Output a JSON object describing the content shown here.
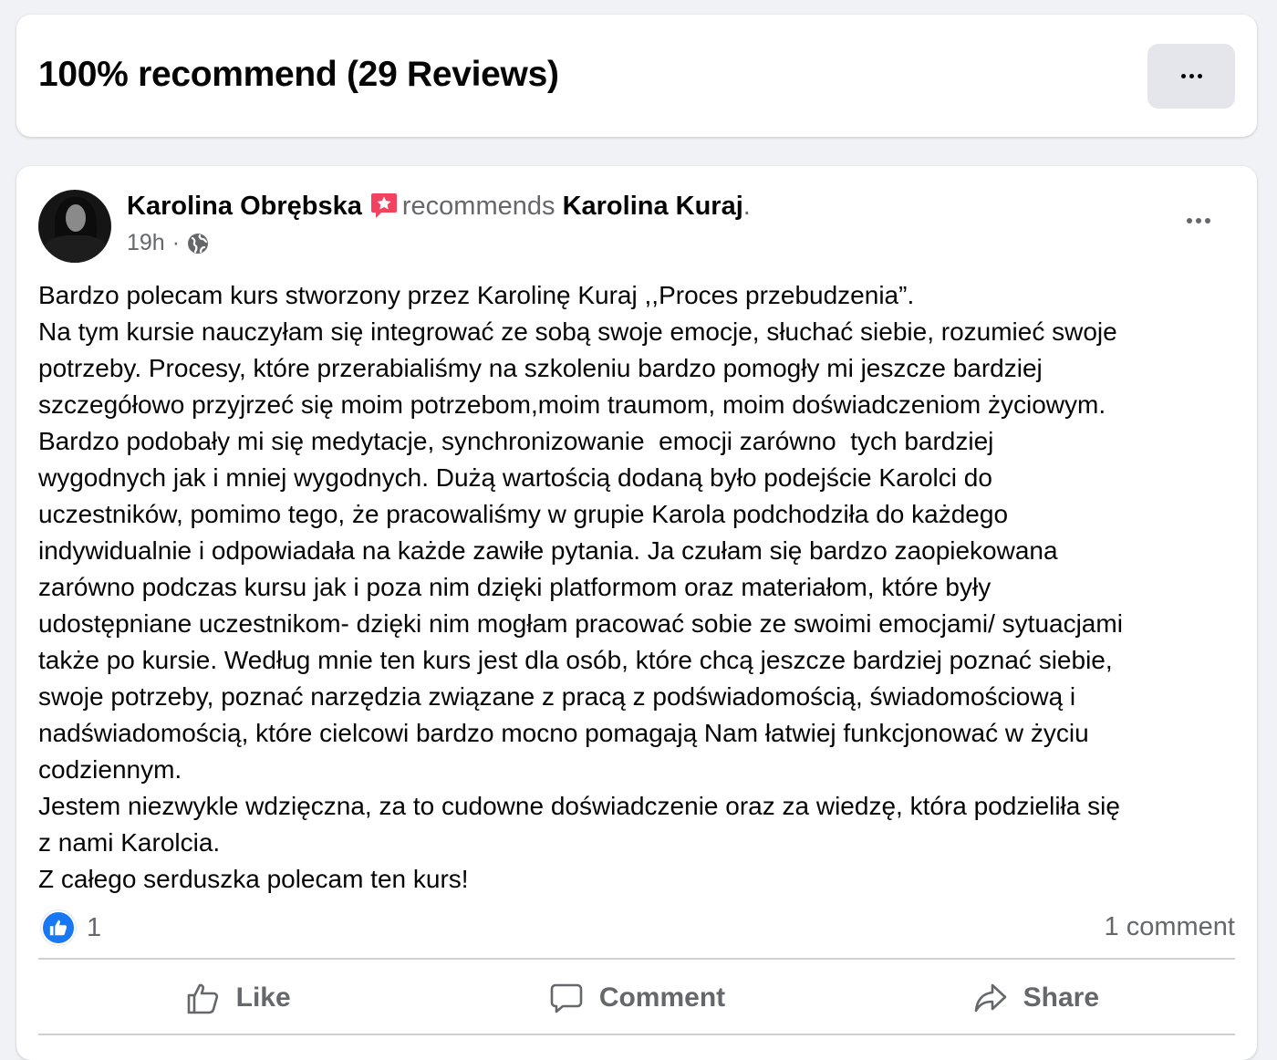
{
  "header": {
    "title": "100% recommend (29 Reviews)",
    "more_icon": "more-horizontal-icon"
  },
  "post": {
    "author": "Karolina Obrębska",
    "recommend_icon": "recommend-badge-icon",
    "action_text": "recommends",
    "target": "Karolina Kuraj",
    "target_suffix": ".",
    "time": "19h",
    "separator": "·",
    "privacy_icon": "globe-icon",
    "more_icon": "more-horizontal-icon",
    "text": "Bardzo polecam kurs stworzony przez Karolinę Kuraj ,,Proces przebudzenia”.\nNa tym kursie nauczyłam się integrować ze sobą swoje emocje, słuchać siebie, rozumieć swoje\npotrzeby. Procesy, które przerabialiśmy na szkoleniu bardzo pomogły mi jeszcze bardziej\nszczegółowo przyjrzeć się moim potrzebom,moim traumom, moim doświadczeniom życiowym.\nBardzo podobały mi się medytacje, synchronizowanie  emocji zarówno  tych bardziej\nwygodnych jak i mniej wygodnych. Dużą wartością dodaną było podejście Karolci do\nuczestników, pomimo tego, że pracowaliśmy w grupie Karola podchodziła do każdego\nindywidualnie i odpowiadała na każde zawiłe pytania. Ja czułam się bardzo zaopiekowana\nzarówno podczas kursu jak i poza nim dzięki platformom oraz materiałom, które były\nudostępniane uczestnikom- dzięki nim mogłam pracować sobie ze swoimi emocjami/ sytuacjami\ntakże po kursie. Według mnie ten kurs jest dla osób, które chcą jeszcze bardziej poznać siebie,\nswoje potrzeby, poznać narzędzia związane z pracą z podświadomością, świadomościową i\nnadświadomością, które cielcowi bardzo mocno pomagają Nam łatwiej funkcjonować w życiu\ncodziennym.\nJestem niezwykle wdzięczna, za to cudowne doświadczenie oraz za wiedzę, która podzieliła się\nz nami Karolcia.\nZ całego serduszka polecam ten kurs!",
    "reaction_count": "1",
    "comment_count": "1 comment"
  },
  "actions": {
    "like": "Like",
    "comment": "Comment",
    "share": "Share"
  },
  "colors": {
    "background": "#f0f2f5",
    "card": "#ffffff",
    "secondary_text": "#65676b",
    "like_blue": "#1877f2",
    "recommend_red": "#f3425f"
  }
}
